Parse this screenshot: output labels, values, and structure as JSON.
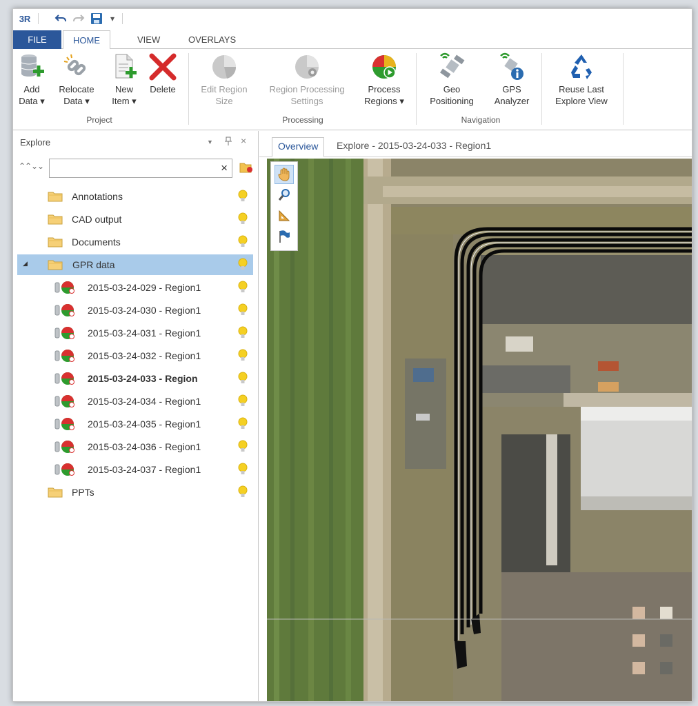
{
  "app": {
    "logo": "3R",
    "colors": {
      "accent": "#2b579a",
      "selection": "#a9cbea",
      "bulb": "#f5d023"
    }
  },
  "ribbon": {
    "tabs": [
      "FILE",
      "HOME",
      "VIEW",
      "OVERLAYS"
    ],
    "active_tab": "HOME",
    "groups": {
      "project": {
        "label": "Project",
        "add_data": [
          "Add",
          "Data ▾"
        ],
        "relocate_data": [
          "Relocate",
          "Data ▾"
        ],
        "new_item": [
          "New",
          "Item ▾"
        ],
        "delete": [
          "Delete",
          ""
        ]
      },
      "processing": {
        "label": "Processing",
        "edit_region_size": [
          "Edit Region",
          "Size"
        ],
        "region_processing_settings": [
          "Region Processing",
          "Settings"
        ],
        "process_regions": [
          "Process",
          "Regions ▾"
        ]
      },
      "navigation": {
        "label": "Navigation",
        "geo_positioning": [
          "Geo",
          "Positioning"
        ],
        "gps_analyzer": [
          "GPS",
          "Analyzer"
        ]
      },
      "reuse": {
        "reuse_last_explore_view": [
          "Reuse Last",
          "Explore View"
        ]
      }
    }
  },
  "explore": {
    "title": "Explore",
    "search": {
      "value": "",
      "placeholder": ""
    },
    "folders": [
      "Annotations",
      "CAD output",
      "Documents"
    ],
    "gpr_folder": "GPR data",
    "gpr_items": [
      "2015-03-24-029 - Region1",
      "2015-03-24-030 - Region1",
      "2015-03-24-031 - Region1",
      "2015-03-24-032 - Region1",
      "2015-03-24-033 - Region",
      "2015-03-24-034 - Region1",
      "2015-03-24-035 - Region1",
      "2015-03-24-036 - Region1",
      "2015-03-24-037 - Region1"
    ],
    "active_item": "2015-03-24-033 - Region",
    "last_folder": "PPTs"
  },
  "document_tabs": {
    "active": "Overview",
    "other": "Explore - 2015-03-24-033 - Region1"
  },
  "map_tools": [
    "pan-hand-icon",
    "zoom-icon",
    "measure-icon",
    "flag-icon"
  ]
}
